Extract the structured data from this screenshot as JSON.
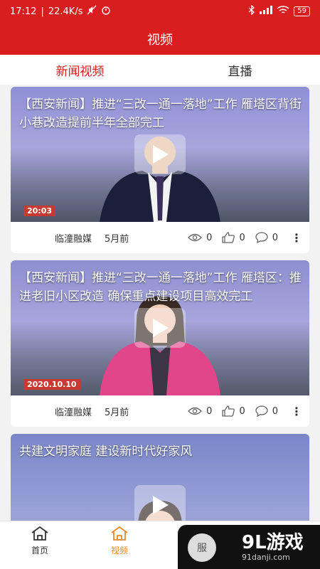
{
  "status_bar": {
    "time": "17:12",
    "speed": "22.4K/s",
    "battery": "59"
  },
  "header": {
    "title": "视频"
  },
  "tabs": [
    {
      "label": "新闻视频",
      "active": true
    },
    {
      "label": "直播",
      "active": false
    }
  ],
  "cards": [
    {
      "title": "【西安新闻】推进“三改一通一落地”工作 雁塔区背街小巷改造提前半年全部完工",
      "stamp": "20:03",
      "source": "临潼融媒",
      "time": "5月前",
      "views": "0",
      "likes": "0",
      "comments": "0",
      "colors": {
        "top": "#8f8fd6",
        "bottom": "#7a7f9c",
        "suit": "#1b1f3a"
      }
    },
    {
      "title": "【西安新闻】推进“三改一通一落地”工作 雁塔区：推进老旧小区改造 确保重点建设项目高效完工",
      "stamp": "2020.10.10",
      "source": "临潼融媒",
      "time": "5月前",
      "views": "0",
      "likes": "0",
      "comments": "0",
      "colors": {
        "top": "#8d8fcf",
        "bottom": "#7d7f9d",
        "suit": "#e2468a"
      }
    },
    {
      "title": "共建文明家庭 建设新时代好家风",
      "stamp": "",
      "source": "",
      "time": "",
      "views": "",
      "likes": "",
      "comments": "",
      "colors": {
        "top": "#7a86c8",
        "bottom": "#8a92c0",
        "suit": "#f08a3a"
      }
    }
  ],
  "bottom_nav": [
    {
      "label": "首页",
      "icon": "home-icon",
      "active": false
    },
    {
      "label": "视频",
      "icon": "video-home-icon",
      "active": true
    },
    {
      "label": "",
      "icon": "home-icon",
      "active": false
    },
    {
      "label": "",
      "icon": "user-icon",
      "active": false
    }
  ],
  "watermark": {
    "brand": "9L游戏",
    "site": "91danji.com",
    "badge": "服"
  },
  "accent": "#d81e1e",
  "nav_active_color": "#e08a2c"
}
